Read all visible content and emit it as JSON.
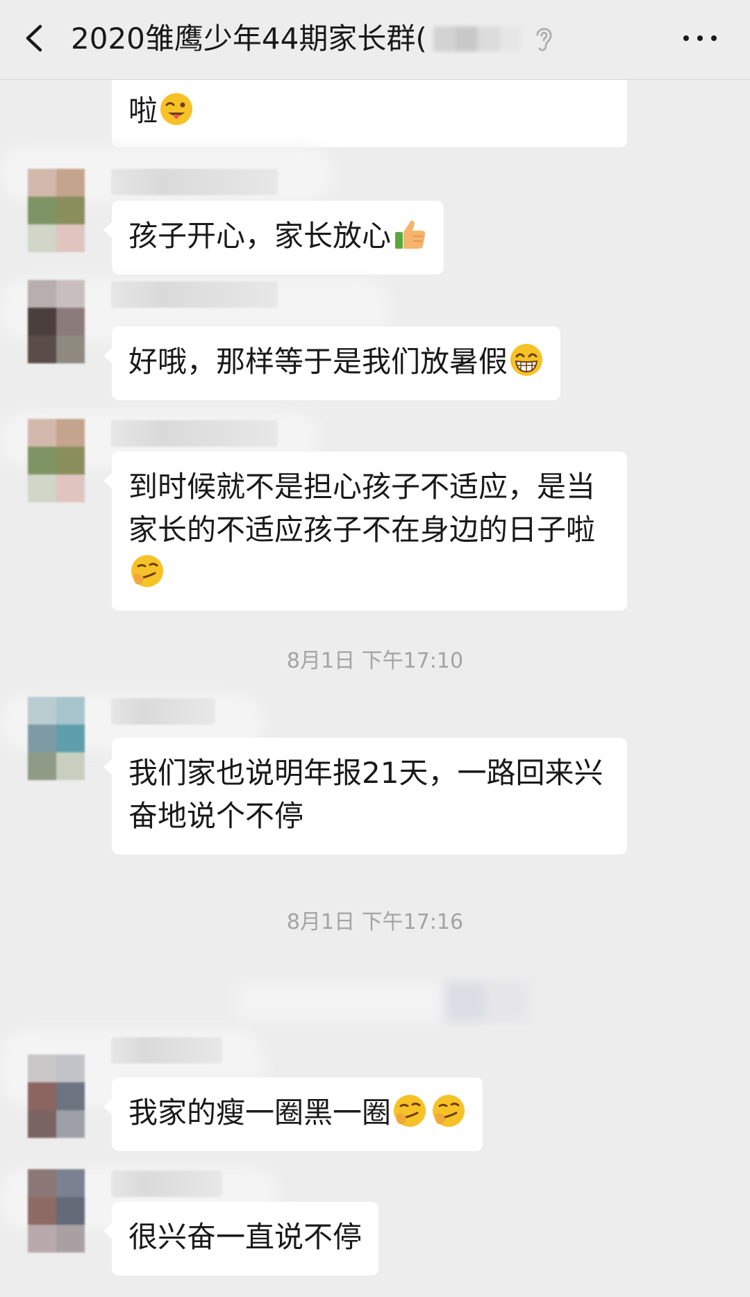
{
  "header": {
    "title": "2020雏鹰少年44期家长群(",
    "back_icon": "chevron-left-icon",
    "mute_icon": "ear-icon",
    "more_icon": "more-dots-icon"
  },
  "messages": [
    {
      "text": "啦",
      "emoji": "winking-tongue-emoji"
    },
    {
      "text": "孩子开心，家长放心",
      "emoji": "thumbs-up-emoji"
    },
    {
      "text": "好哦，那样等于是我们放暑假",
      "emoji": "grinning-emoji"
    },
    {
      "text": "到时候就不是担心孩子不适应，是当家长的不适应孩子不在身边的日子啦",
      "emoji": "smirk-emoji"
    },
    {
      "text": "我们家也说明年报21天，一路回来兴奋地说个不停"
    },
    {
      "text": "我家的瘦一圈黑一圈",
      "emoji": "smirk-emoji"
    },
    {
      "text": "很兴奋一直说不停"
    }
  ],
  "timestamps": [
    "8月1日 下午17:10",
    "8月1日 下午17:16"
  ],
  "colors": {
    "background": "#ededed",
    "bubble": "#ffffff",
    "text": "#191919",
    "timestamp": "#a3a3a3",
    "emoji_yellow": "#f7c227"
  }
}
